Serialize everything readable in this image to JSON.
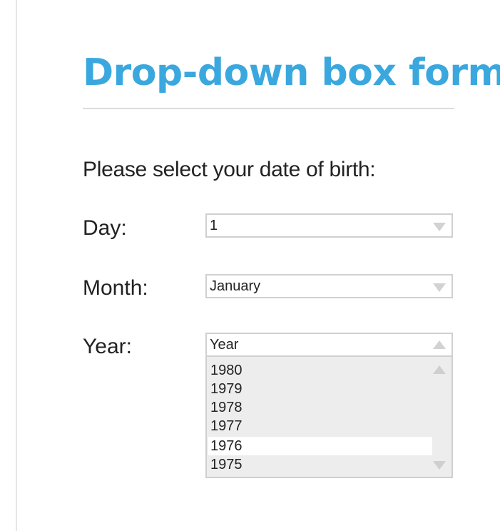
{
  "page": {
    "title": "Drop-down box form",
    "prompt": "Please select your date of birth:"
  },
  "colors": {
    "title": "#3aa8de",
    "text": "#222222",
    "border": "#d0d0d0",
    "list_background": "#ededed",
    "selected_item_background": "#ffffff"
  },
  "form": {
    "day": {
      "label": "Day:",
      "value": "1",
      "icon": "chevron-down-icon"
    },
    "month": {
      "label": "Month:",
      "value": "January",
      "icon": "chevron-down-icon"
    },
    "year": {
      "label": "Year:",
      "value": "Year",
      "icon": "chevron-up-icon",
      "expanded": true,
      "options": [
        "1980",
        "1979",
        "1978",
        "1977",
        "1976",
        "1975"
      ],
      "highlighted_option": "1976"
    }
  }
}
